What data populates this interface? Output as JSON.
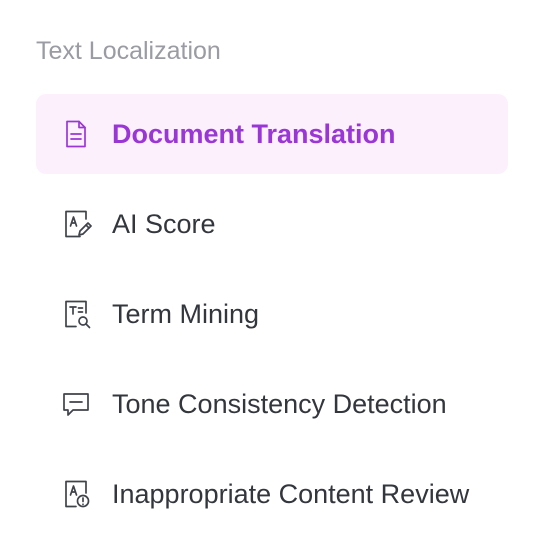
{
  "section": {
    "title": "Text Localization"
  },
  "colors": {
    "accent": "#9b36d6",
    "active_background": "#fcf0fd",
    "text": "#33363d",
    "muted": "#9a9ba3"
  },
  "menu": {
    "items": [
      {
        "label": "Document Translation",
        "icon": "document-icon",
        "active": true
      },
      {
        "label": "AI Score",
        "icon": "ai-score-icon",
        "active": false
      },
      {
        "label": "Term Mining",
        "icon": "term-mining-icon",
        "active": false
      },
      {
        "label": "Tone Consistency Detection",
        "icon": "chat-bubble-icon",
        "active": false
      },
      {
        "label": "Inappropriate Content Review",
        "icon": "content-review-icon",
        "active": false
      }
    ]
  }
}
